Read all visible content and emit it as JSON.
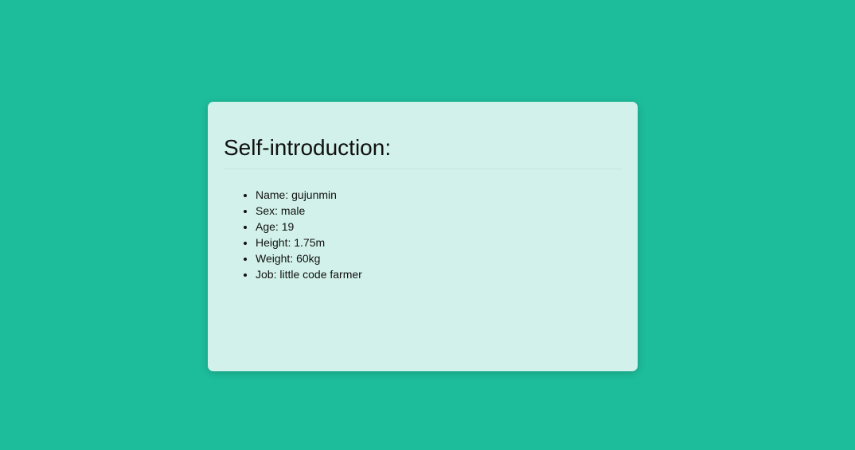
{
  "card": {
    "title": "Self-introduction:",
    "items": [
      "Name: gujunmin",
      "Sex: male",
      "Age: 19",
      "Height: 1.75m",
      "Weight: 60kg",
      "Job: little code farmer"
    ]
  },
  "colors": {
    "background": "#1dbd9b",
    "card": "#d2f1ea"
  }
}
